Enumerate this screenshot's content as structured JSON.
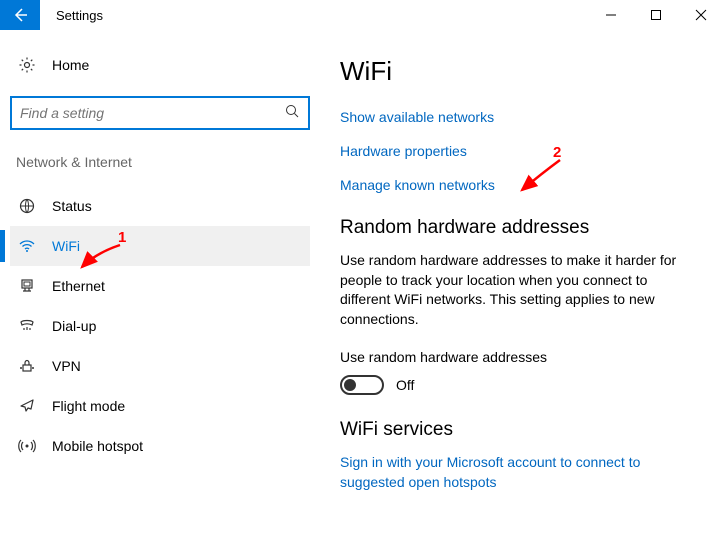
{
  "titlebar": {
    "title": "Settings"
  },
  "sidebar": {
    "home_label": "Home",
    "search_placeholder": "Find a setting",
    "category": "Network & Internet",
    "items": [
      {
        "label": "Status",
        "icon": "status"
      },
      {
        "label": "WiFi",
        "icon": "wifi",
        "active": true
      },
      {
        "label": "Ethernet",
        "icon": "ethernet"
      },
      {
        "label": "Dial-up",
        "icon": "dialup"
      },
      {
        "label": "VPN",
        "icon": "vpn"
      },
      {
        "label": "Flight mode",
        "icon": "flight"
      },
      {
        "label": "Mobile hotspot",
        "icon": "hotspot"
      }
    ]
  },
  "main": {
    "title": "WiFi",
    "links": {
      "show_networks": "Show available networks",
      "hw_props": "Hardware properties",
      "manage_known": "Manage known networks"
    },
    "random_section": {
      "title": "Random hardware addresses",
      "desc": "Use random hardware addresses to make it harder for people to track your location when you connect to different WiFi networks. This setting applies to new connections.",
      "setting_label": "Use random hardware addresses",
      "toggle_state": "Off"
    },
    "services_section": {
      "title": "WiFi services",
      "link": "Sign in with your Microsoft account to connect to suggested open hotspots"
    }
  },
  "annotations": {
    "num1": "1",
    "num2": "2"
  }
}
